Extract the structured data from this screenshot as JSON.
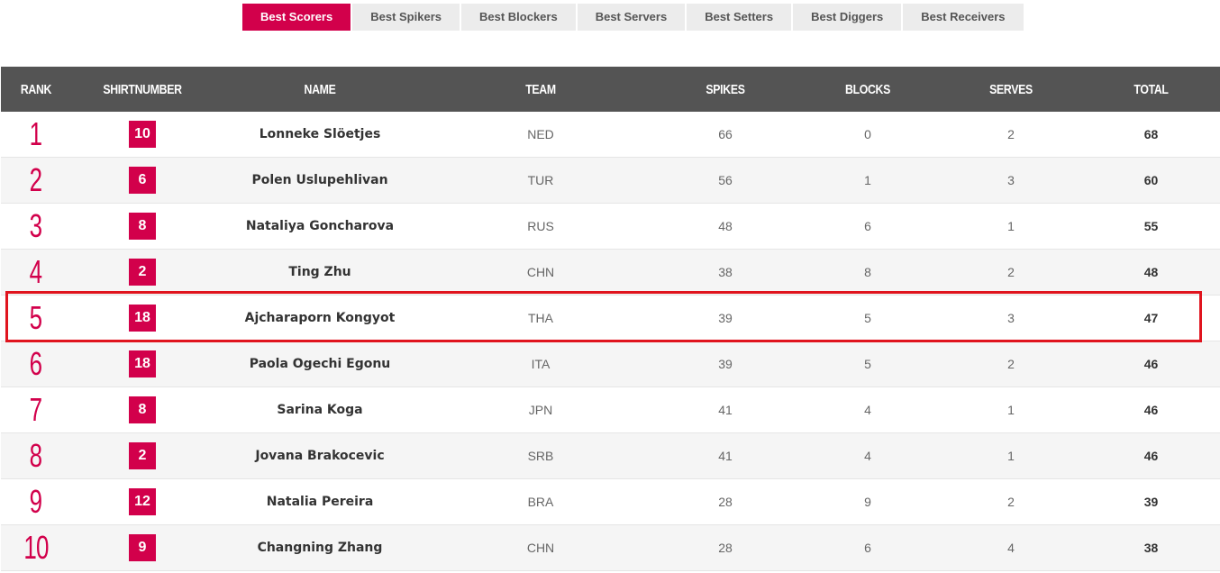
{
  "tabs": [
    {
      "label": "Best Scorers",
      "active": true
    },
    {
      "label": "Best Spikers",
      "active": false
    },
    {
      "label": "Best Blockers",
      "active": false
    },
    {
      "label": "Best Servers",
      "active": false
    },
    {
      "label": "Best Setters",
      "active": false
    },
    {
      "label": "Best Diggers",
      "active": false
    },
    {
      "label": "Best Receivers",
      "active": false
    }
  ],
  "columns": {
    "rank": "RANK",
    "shirt": "SHIRTNUMBER",
    "name": "NAME",
    "team": "TEAM",
    "spikes": "SPIKES",
    "blocks": "BLOCKS",
    "serves": "SERVES",
    "total": "TOTAL"
  },
  "rows": [
    {
      "rank": "1",
      "shirt": "10",
      "name": "Lonneke Slöetjes",
      "team": "NED",
      "spikes": "66",
      "blocks": "0",
      "serves": "2",
      "total": "68"
    },
    {
      "rank": "2",
      "shirt": "6",
      "name": "Polen Uslupehlivan",
      "team": "TUR",
      "spikes": "56",
      "blocks": "1",
      "serves": "3",
      "total": "60"
    },
    {
      "rank": "3",
      "shirt": "8",
      "name": "Nataliya Goncharova",
      "team": "RUS",
      "spikes": "48",
      "blocks": "6",
      "serves": "1",
      "total": "55"
    },
    {
      "rank": "4",
      "shirt": "2",
      "name": "Ting Zhu",
      "team": "CHN",
      "spikes": "38",
      "blocks": "8",
      "serves": "2",
      "total": "48"
    },
    {
      "rank": "5",
      "shirt": "18",
      "name": "Ajcharaporn Kongyot",
      "team": "THA",
      "spikes": "39",
      "blocks": "5",
      "serves": "3",
      "total": "47"
    },
    {
      "rank": "6",
      "shirt": "18",
      "name": "Paola Ogechi Egonu",
      "team": "ITA",
      "spikes": "39",
      "blocks": "5",
      "serves": "2",
      "total": "46"
    },
    {
      "rank": "7",
      "shirt": "8",
      "name": "Sarina Koga",
      "team": "JPN",
      "spikes": "41",
      "blocks": "4",
      "serves": "1",
      "total": "46"
    },
    {
      "rank": "8",
      "shirt": "2",
      "name": "Jovana Brakocevic",
      "team": "SRB",
      "spikes": "41",
      "blocks": "4",
      "serves": "1",
      "total": "46"
    },
    {
      "rank": "9",
      "shirt": "12",
      "name": "Natalia Pereira",
      "team": "BRA",
      "spikes": "28",
      "blocks": "9",
      "serves": "2",
      "total": "39"
    },
    {
      "rank": "10",
      "shirt": "9",
      "name": "Changning Zhang",
      "team": "CHN",
      "spikes": "28",
      "blocks": "6",
      "serves": "4",
      "total": "38"
    }
  ],
  "highlighted_rank": "5",
  "colors": {
    "accent": "#d2004b",
    "header_bg": "#545454",
    "highlight_border": "#e0141e"
  }
}
